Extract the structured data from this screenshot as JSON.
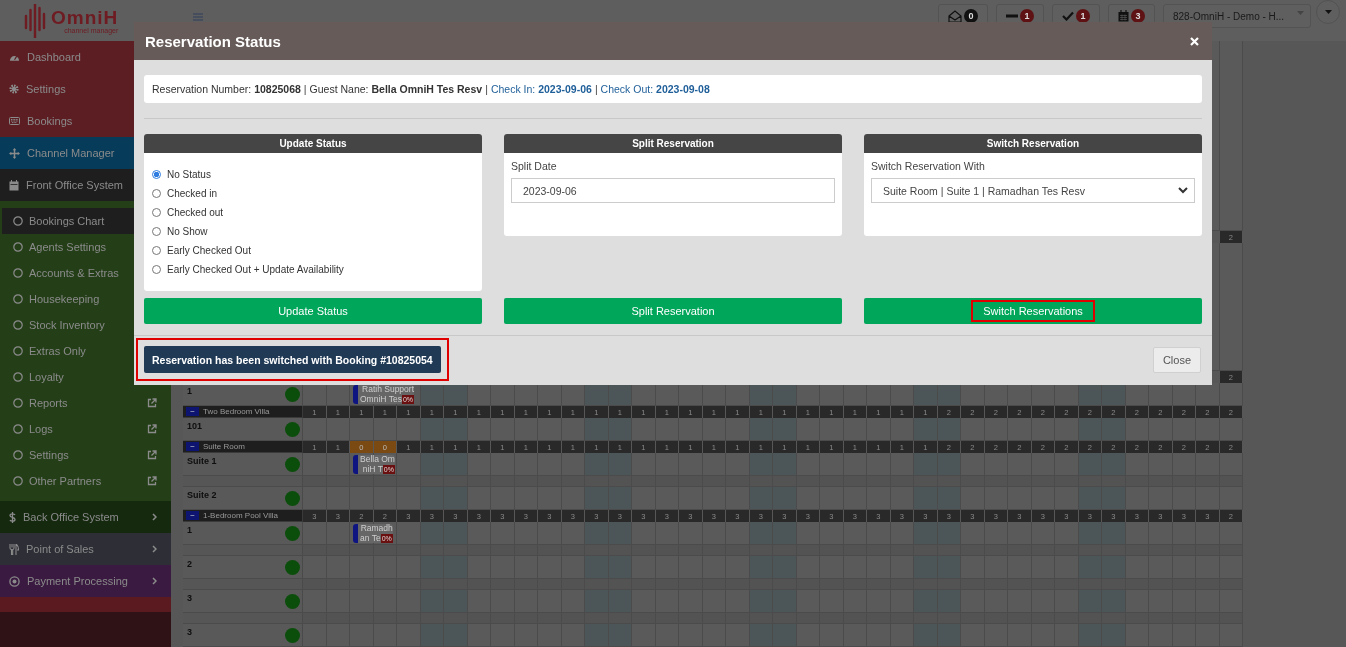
{
  "topbar": {
    "logo": {
      "name": "OmniH",
      "tagline": "channel manager"
    },
    "notifications": [
      {
        "kind": "mail",
        "count": "0",
        "color": "#111111"
      },
      {
        "kind": "minus",
        "count": "1",
        "color": "#5e1214"
      },
      {
        "kind": "check",
        "count": "1",
        "color": "#5e1214"
      },
      {
        "kind": "calendar",
        "count": "3",
        "color": "#5e1214"
      }
    ],
    "property_select": {
      "value": "828-OmniH - Demo - H..."
    }
  },
  "sidebar": {
    "items": [
      {
        "kind": "link",
        "label": "Dashboard",
        "color": "#5c1e23"
      },
      {
        "kind": "link",
        "label": "Settings",
        "color": "#5c1e23"
      },
      {
        "kind": "link",
        "label": "Bookings",
        "color": "#5c1e23"
      },
      {
        "kind": "link",
        "label": "Channel Manager",
        "color": "#063b5a"
      },
      {
        "kind": "group",
        "label": "Front Office System",
        "color": "#1e1e1e",
        "expanded": true,
        "children": [
          {
            "label": "Bookings Chart",
            "selected": true
          },
          {
            "label": "Agents Settings",
            "selected": false
          },
          {
            "label": "Accounts & Extras",
            "selected": false
          },
          {
            "label": "Housekeeping",
            "selected": false
          },
          {
            "label": "Stock Inventory",
            "selected": false
          },
          {
            "label": "Extras Only",
            "selected": false
          },
          {
            "label": "Loyalty",
            "selected": false
          },
          {
            "label": "Reports",
            "selected": false,
            "external": true
          },
          {
            "label": "Logs",
            "selected": false,
            "external": true
          },
          {
            "label": "Settings",
            "selected": false,
            "external": true
          },
          {
            "label": "Other Partners",
            "selected": false,
            "external": true
          }
        ]
      },
      {
        "kind": "group",
        "label": "Back Office System",
        "color": "#15290f",
        "expanded": false
      },
      {
        "kind": "group",
        "label": "Point of Sales",
        "color": "#2d2e36",
        "expanded": false
      },
      {
        "kind": "group",
        "label": "Payment Processing",
        "color": "#3a1a40",
        "expanded": false
      }
    ]
  },
  "chart": {
    "rows": [
      {
        "kind": "covered"
      },
      {
        "kind": "category",
        "counts": [
          "2"
        ]
      },
      {
        "kind": "covered"
      },
      {
        "kind": "category",
        "counts": [
          "2"
        ]
      },
      {
        "kind": "room",
        "name": "1",
        "booking": {
          "lines": [
            "Ratih Support",
            "OmniH Tes"
          ],
          "discount": "0%"
        }
      },
      {
        "kind": "category",
        "name": "Two Bedroom Villa",
        "toggle": "−",
        "counts": [
          "1",
          "1",
          "1",
          "1",
          "1",
          "1",
          "1",
          "1",
          "1",
          "1",
          "1",
          "1",
          "1",
          "1",
          "1",
          "1",
          "1",
          "1",
          "1",
          "1",
          "1",
          "1",
          "1",
          "1",
          "1",
          "1",
          "1",
          "2",
          "2",
          "2",
          "2",
          "2",
          "2",
          "2",
          "2",
          "2",
          "2",
          "2",
          "2",
          "2"
        ]
      },
      {
        "kind": "room",
        "name": "101"
      },
      {
        "kind": "category",
        "name": "Suite Room",
        "toggle": "−",
        "counts": [
          "1",
          "1",
          "0",
          "0",
          "1",
          "1",
          "1",
          "1",
          "1",
          "1",
          "1",
          "1",
          "1",
          "1",
          "1",
          "1",
          "1",
          "1",
          "1",
          "1",
          "1",
          "1",
          "1",
          "1",
          "1",
          "1",
          "1",
          "2",
          "2",
          "2",
          "2",
          "2",
          "2",
          "2",
          "2",
          "2",
          "2",
          "2",
          "2",
          "2"
        ]
      },
      {
        "kind": "room",
        "name": "Suite 1",
        "booking": {
          "lines": [
            "Bella Om",
            "niH T"
          ],
          "discount": "0%"
        }
      },
      {
        "kind": "spacer"
      },
      {
        "kind": "room",
        "name": "Suite 2"
      },
      {
        "kind": "category",
        "name": "1-Bedroom Pool Villa",
        "toggle": "−",
        "counts": [
          "3",
          "3",
          "2",
          "2",
          "3",
          "3",
          "3",
          "3",
          "3",
          "3",
          "3",
          "3",
          "3",
          "3",
          "3",
          "3",
          "3",
          "3",
          "3",
          "3",
          "3",
          "3",
          "3",
          "3",
          "3",
          "3",
          "3",
          "3",
          "3",
          "3",
          "3",
          "3",
          "3",
          "3",
          "3",
          "3",
          "3",
          "3",
          "3",
          "2"
        ]
      },
      {
        "kind": "room",
        "name": "1",
        "booking": {
          "lines": [
            "Ramadh",
            "an Te"
          ],
          "discount": "0%"
        }
      },
      {
        "kind": "spacer"
      },
      {
        "kind": "room",
        "name": "2"
      },
      {
        "kind": "spacer"
      },
      {
        "kind": "room",
        "name": "3"
      },
      {
        "kind": "spacer"
      },
      {
        "kind": "room",
        "name": "3"
      }
    ]
  },
  "modal": {
    "title": "Reservation Status",
    "info": {
      "separator": "|",
      "items": [
        {
          "label": "Reservation Number:",
          "value": "10825068",
          "color": "#333333"
        },
        {
          "label": "Guest Nane:",
          "value": "Bella OmniH Tes Resv",
          "color": "#333333"
        },
        {
          "label": "Check In:",
          "value": "2023-09-06",
          "color": "#1f5f99"
        },
        {
          "label": "Check Out:",
          "value": "2023-09-08",
          "color": "#1f5f99"
        }
      ]
    },
    "panels": [
      {
        "kind": "radios",
        "title": "Update Status",
        "options": [
          {
            "label": "No Status",
            "selected": true
          },
          {
            "label": "Checked in",
            "selected": false
          },
          {
            "label": "Checked out",
            "selected": false
          },
          {
            "label": "No Show",
            "selected": false
          },
          {
            "label": "Early Checked Out",
            "selected": false
          },
          {
            "label": "Early Checked Out + Update Availability",
            "selected": false
          }
        ]
      },
      {
        "kind": "date",
        "title": "Split Reservation",
        "field_label": "Split Date",
        "value": "2023-09-06"
      },
      {
        "kind": "select",
        "title": "Switch Reservation",
        "field_label": "Switch Reservation With",
        "value": "Suite Room | Suite 1 | Ramadhan Tes Resv"
      }
    ],
    "actions": [
      {
        "label": "Update Status",
        "highlighted": false
      },
      {
        "label": "Split Reservation",
        "highlighted": false
      },
      {
        "label": "Switch Reservations",
        "highlighted": true
      }
    ],
    "message": {
      "text": "Reservation has been switched with Booking #10825054",
      "highlighted": true
    },
    "close_button": "Close"
  }
}
